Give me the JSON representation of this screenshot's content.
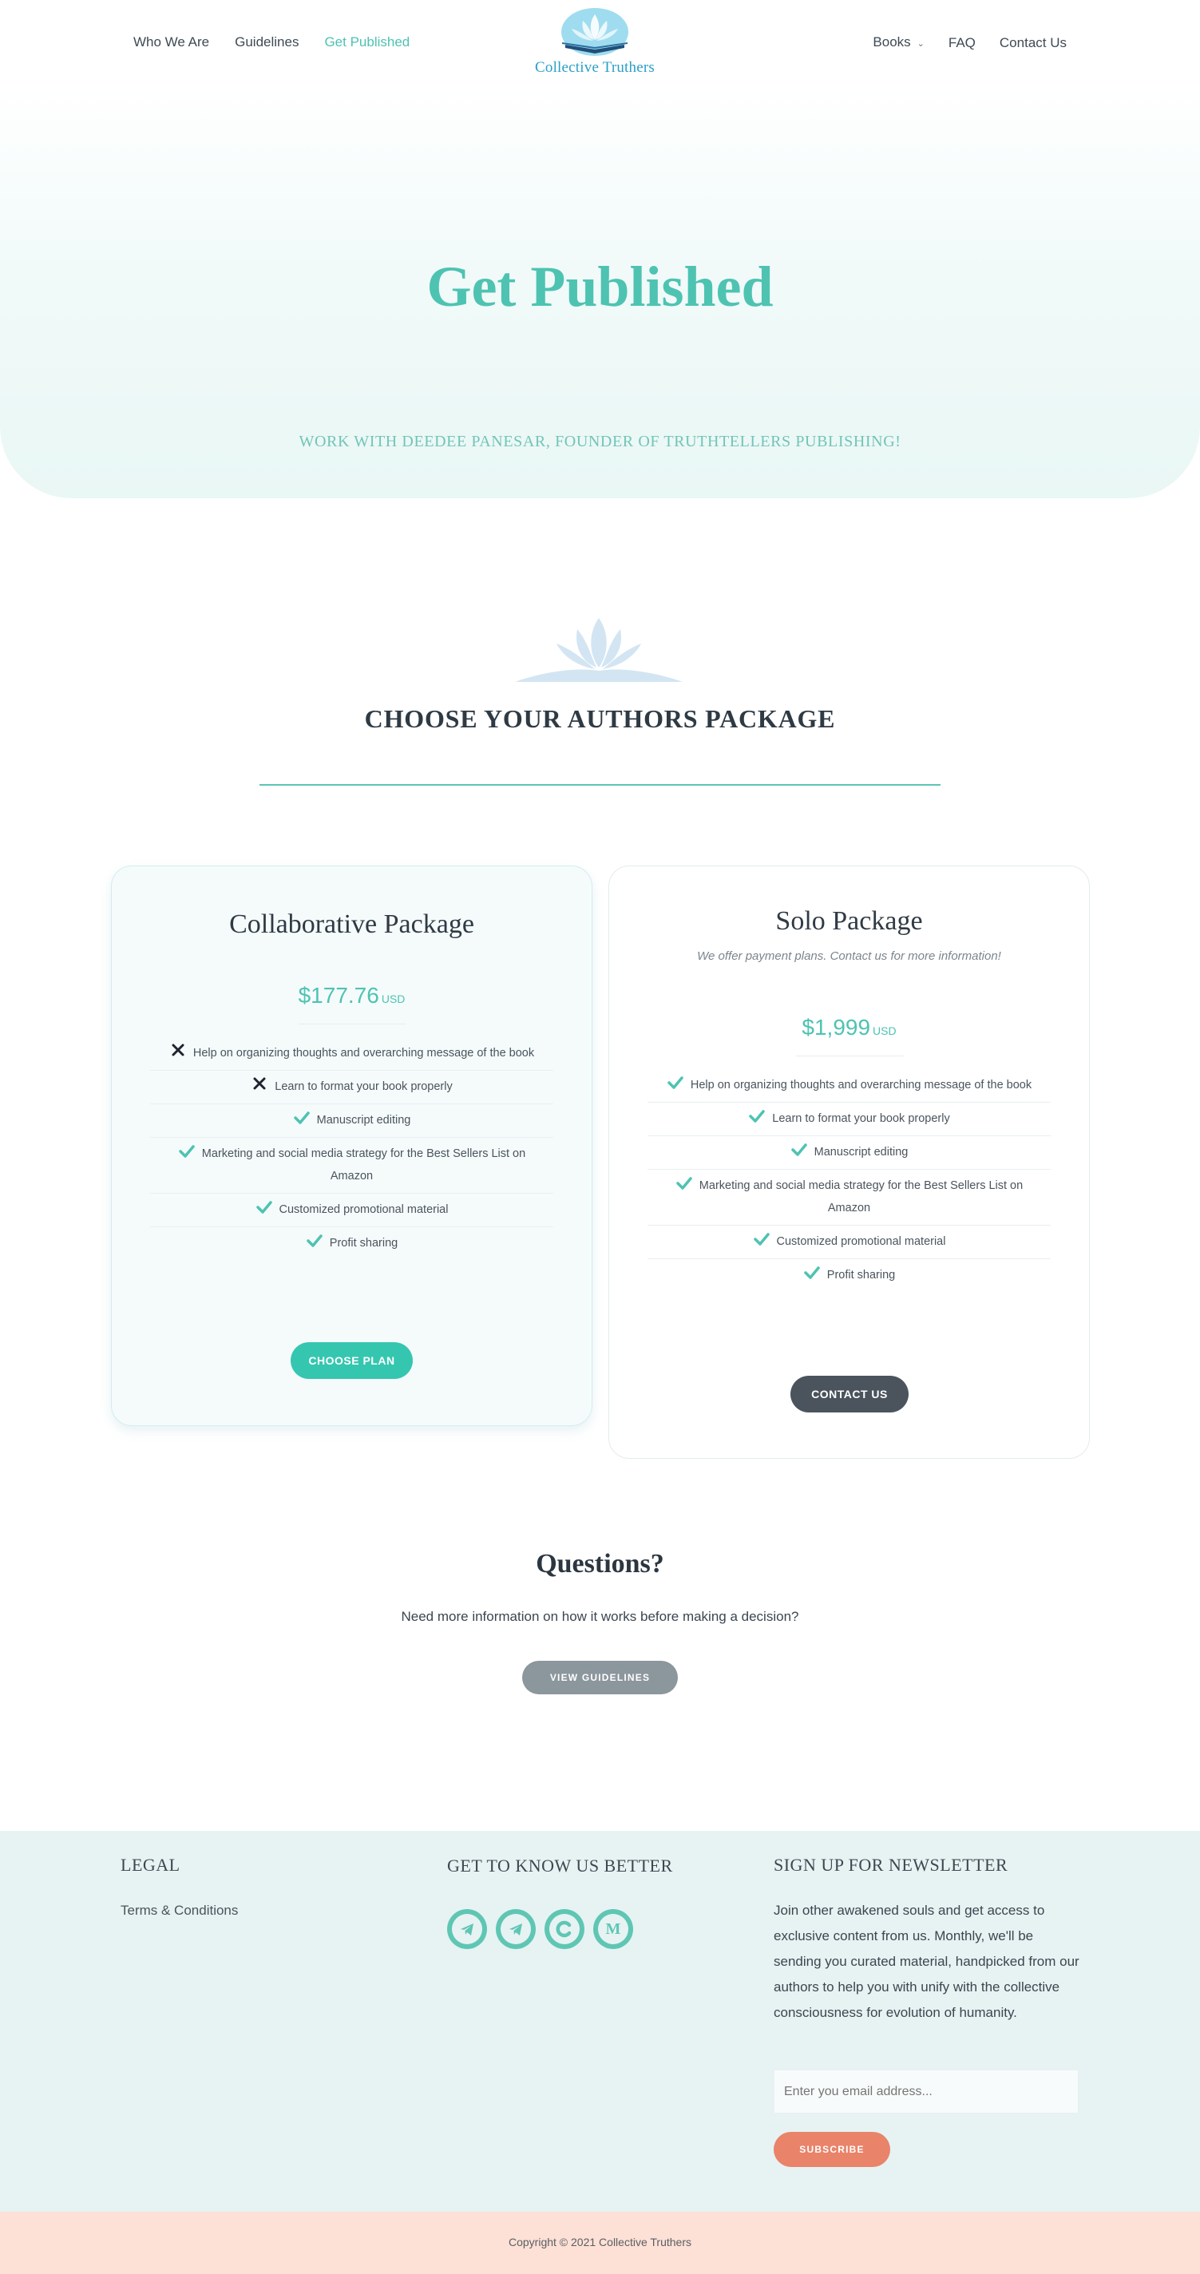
{
  "header": {
    "nav_left": [
      "Who We Are",
      "Guidelines",
      "Get Published"
    ],
    "active_item": "Get Published",
    "logo_text": "Collective Truthers",
    "nav_right": {
      "books": "Books",
      "faq": "FAQ",
      "contact": "Contact Us"
    }
  },
  "hero": {
    "title": "Get Published",
    "subtitle": "WORK WITH DEEDEE PANESAR, FOUNDER OF TRUTHTELLERS PUBLISHING!"
  },
  "packages_section": {
    "title": "CHOOSE YOUR AUTHORS PACKAGE"
  },
  "collab": {
    "title": "Collaborative Package",
    "price": "$177.76",
    "currency": "USD",
    "features": [
      {
        "text": "Help on organizing thoughts and overarching message of the book",
        "included": false
      },
      {
        "text": "Learn to format your book properly",
        "included": false
      },
      {
        "text": "Manuscript editing",
        "included": true
      },
      {
        "text": "Marketing and social media strategy for the Best Sellers List on Amazon",
        "included": true
      },
      {
        "text": "Customized promotional material",
        "included": true
      },
      {
        "text": "Profit sharing",
        "included": true
      }
    ],
    "button": "CHOOSE PLAN"
  },
  "solo": {
    "title": "Solo Package",
    "note": "We offer payment plans. Contact us for more information!",
    "price": "$1,999",
    "currency": "USD",
    "features": [
      {
        "text": "Help on organizing thoughts and overarching message of the book",
        "included": true
      },
      {
        "text": "Learn to format your book properly",
        "included": true
      },
      {
        "text": "Manuscript editing",
        "included": true
      },
      {
        "text": "Marketing and social media strategy for the Best Sellers List on Amazon",
        "included": true
      },
      {
        "text": "Customized promotional material",
        "included": true
      },
      {
        "text": "Profit sharing",
        "included": true
      }
    ],
    "button": "CONTACT US"
  },
  "questions": {
    "title": "Questions?",
    "text": "Need more information on how it works before making a decision?",
    "button": "VIEW GUIDELINES"
  },
  "footer": {
    "legal_title": "LEGAL",
    "legal_link": "Terms & Conditions",
    "social_title": "GET TO KNOW US BETTER",
    "socials": [
      {
        "icon": "telegram-icon"
      },
      {
        "icon": "telegram-icon"
      },
      {
        "icon": "c-icon"
      },
      {
        "icon": "medium-icon",
        "glyph": "M"
      }
    ],
    "newsletter_title": "SIGN UP FOR NEWSLETTER",
    "newsletter_text": "Join other awakened souls and get access to exclusive content from us. Monthly, we'll be sending you curated material, handpicked from our authors to help you with unify with the collective consciousness for evolution of humanity.",
    "email_placeholder": "Enter you email address...",
    "subscribe": "SUBSCRIBE",
    "copyright": "Copyright © 2021 Collective Truthers"
  },
  "colors": {
    "accent": "#4ec3b2",
    "button_teal": "#35c6b0",
    "button_dark": "#4b545d",
    "button_orange": "#e9836a",
    "footer_bg": "#e6f3f2",
    "copyright_bg": "#fde0d6"
  }
}
